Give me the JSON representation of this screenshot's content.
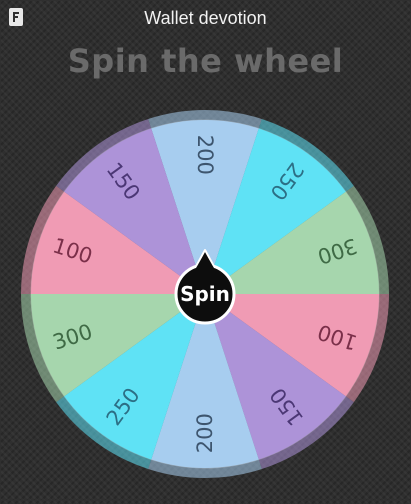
{
  "window": {
    "title": "Wallet devotion"
  },
  "app_icon": "app-logo-icon",
  "heading": "Spin the wheel",
  "wheel": {
    "spin_label": "Spin",
    "segments": [
      {
        "label": "200",
        "color": "#a7cdef",
        "text_color": "#3d556e"
      },
      {
        "label": "250",
        "color": "#5fe2f5",
        "text_color": "#2c6f85"
      },
      {
        "label": "300",
        "color": "#a6d6ad",
        "text_color": "#3f6a45"
      },
      {
        "label": "100",
        "color": "#f09bb4",
        "text_color": "#7a2f49"
      },
      {
        "label": "150",
        "color": "#ad93d8",
        "text_color": "#4b3775"
      },
      {
        "label": "200",
        "color": "#a7cdef",
        "text_color": "#3d556e"
      },
      {
        "label": "250",
        "color": "#5fe2f5",
        "text_color": "#2c6f85"
      },
      {
        "label": "300",
        "color": "#a6d6ad",
        "text_color": "#3f6a45"
      },
      {
        "label": "100",
        "color": "#f09bb4",
        "text_color": "#7a2f49"
      },
      {
        "label": "150",
        "color": "#ad93d8",
        "text_color": "#4b3775"
      }
    ]
  }
}
